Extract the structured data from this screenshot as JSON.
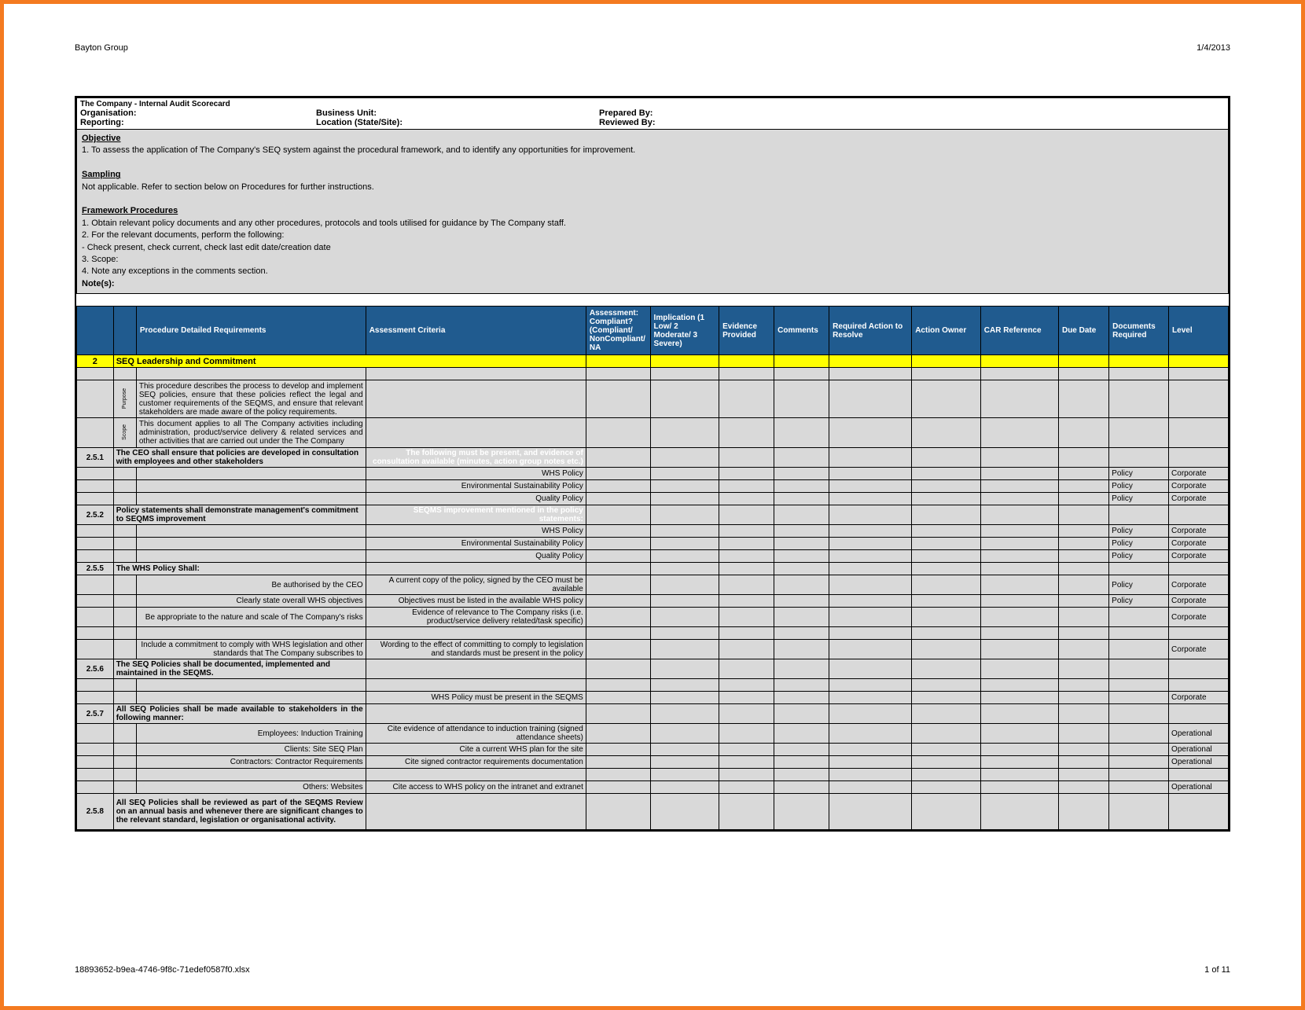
{
  "page_header_left": "Bayton Group",
  "page_header_right": "1/4/2013",
  "page_footer_left": "18893652-b9ea-4746-9f8c-71edef0587f0.xlsx",
  "page_footer_right": "1 of 11",
  "meta": {
    "title": "The Company - Internal Audit Scorecard",
    "org": "Organisation:",
    "bu": "Business Unit:",
    "prep": "Prepared By:",
    "rep": "Reporting:",
    "loc": "Location (State/Site):",
    "rev": "Reviewed By:"
  },
  "instr": {
    "obj_h": "Objective",
    "obj_1": "1. To assess the application of The Company's SEQ system against the procedural framework, and to identify any opportunities for improvement.",
    "samp_h": "Sampling",
    "samp_t": "Not applicable. Refer to section below on Procedures for further instructions.",
    "fp_h": "Framework Procedures",
    "fp_1": "1. Obtain relevant policy documents and any other procedures, protocols and tools utilised for guidance by The Company staff.",
    "fp_2": "2. For the relevant documents, perform the following:",
    "fp_2a": " - Check present, check current, check last edit date/creation date",
    "fp_3": "3. Scope:",
    "fp_4": "4. Note any exceptions in the comments section.",
    "notes": "Note(s):"
  },
  "cols": {
    "req": "Procedure Detailed Requirements",
    "ac": "Assessment Criteria",
    "ass": "Assessment: Compliant? (Compliant/ NonCompliant/ NA",
    "imp": "Implication (1 Low/ 2 Moderate/ 3 Severe)",
    "ev": "Evidence Provided",
    "com": "Comments",
    "ra": "Required Action to Resolve",
    "ao": "Action Owner",
    "car": "CAR Reference",
    "dd": "Due Date",
    "doc": "Documents Required",
    "lvl": "Level"
  },
  "section2": {
    "num": "2",
    "title": "SEQ Leadership and Commitment"
  },
  "side": {
    "purpose": "Purpose",
    "scope": "Scope"
  },
  "rows": {
    "purpose": "This procedure describes the process to develop and implement SEQ policies, ensure that these policies reflect the legal and customer requirements of the SEQMS, and ensure that relevant stakeholders are made aware of the policy requirements.",
    "scope": "This document applies to all The Company activities including administration, product/service delivery & related services and other activities that are carried out under the The Company",
    "r251_num": "2.5.1",
    "r251_req": "The CEO shall ensure that policies are developed in consultation with employees and other stakeholders",
    "r251_ac": "The following must be present, and evidence of consultation available (minutes, action group notes etc.)",
    "whs": "WHS Policy",
    "esp": "Environmental Sustainability Policy",
    "qp": "Quality Policy",
    "r252_num": "2.5.2",
    "r252_req": "Policy statements shall demonstrate management's commitment to SEQMS improvement",
    "r252_ac": "SEQMS improvement mentioned in the policy statements:",
    "r255_num": "2.5.5",
    "r255_req": "The WHS Policy Shall:",
    "r255a_req": "Be authorised by the CEO",
    "r255a_ac": "A current copy of the policy, signed by the CEO must be available",
    "r255b_req": "Clearly state overall WHS objectives",
    "r255b_ac": "Objectives must be listed in the available WHS policy",
    "r255c_req": "Be appropriate to the nature and scale of The Company's risks",
    "r255c_ac": "Evidence of relevance to The Company risks (i.e. product/service delivery related/task specific)",
    "r255d_req": "Include a commitment to comply with WHS legislation and other standards that The Company subscribes to",
    "r255d_ac": "Wording to the effect of committing to comply to legislation and standards must be present in the policy",
    "r256_num": "2.5.6",
    "r256_req": "The SEQ Policies shall be documented, implemented and maintained in the SEQMS.",
    "r256_ac": "WHS Policy must be present in the SEQMS",
    "r257_num": "2.5.7",
    "r257_req": "All SEQ Policies shall be made available to stakeholders in the following manner:",
    "r257a_req": "Employees: Induction Training",
    "r257a_ac": "Cite evidence of attendance to induction training (signed attendance sheets)",
    "r257b_req": "Clients: Site SEQ Plan",
    "r257b_ac": "Cite a current WHS plan for the site",
    "r257c_req": "Contractors: Contractor Requirements",
    "r257c_ac": "Cite signed contractor requirements documentation",
    "r257d_req": "Others: Websites",
    "r257d_ac": "Cite access to WHS policy on the intranet and extranet",
    "r258_num": "2.5.8",
    "r258_req": "All SEQ Policies shall be reviewed as part of the SEQMS Review on an annual basis and whenever there are significant changes to the relevant standard, legislation or organisational activity."
  },
  "vals": {
    "policy": "Policy",
    "corporate": "Corporate",
    "operational": "Operational"
  }
}
